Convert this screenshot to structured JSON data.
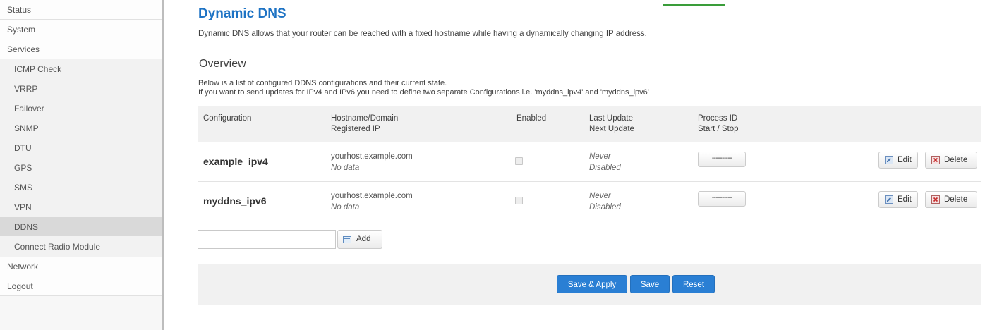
{
  "sidebar": {
    "items": [
      {
        "label": "Status",
        "level": "top"
      },
      {
        "label": "System",
        "level": "top"
      },
      {
        "label": "Services",
        "level": "top"
      },
      {
        "label": "ICMP Check",
        "level": "sub"
      },
      {
        "label": "VRRP",
        "level": "sub"
      },
      {
        "label": "Failover",
        "level": "sub"
      },
      {
        "label": "SNMP",
        "level": "sub"
      },
      {
        "label": "DTU",
        "level": "sub"
      },
      {
        "label": "GPS",
        "level": "sub"
      },
      {
        "label": "SMS",
        "level": "sub"
      },
      {
        "label": "VPN",
        "level": "sub"
      },
      {
        "label": "DDNS",
        "level": "sub",
        "active": true
      },
      {
        "label": "Connect Radio Module",
        "level": "sub"
      },
      {
        "label": "Network",
        "level": "top"
      },
      {
        "label": "Logout",
        "level": "top"
      }
    ]
  },
  "page": {
    "title": "Dynamic DNS",
    "description": "Dynamic DNS allows that your router can be reached with a fixed hostname while having a dynamically changing IP address."
  },
  "overview": {
    "title": "Overview",
    "desc1": "Below is a list of configured DDNS configurations and their current state.",
    "desc2": "If you want to send updates for IPv4 and IPv6 you need to define two separate Configurations i.e. 'myddns_ipv4' and 'myddns_ipv6'"
  },
  "table": {
    "headers": {
      "configuration": "Configuration",
      "hostname": "Hostname/Domain",
      "registered_ip": "Registered IP",
      "enabled": "Enabled",
      "last_update": "Last Update",
      "next_update": "Next Update",
      "process_id": "Process ID",
      "start_stop": "Start / Stop"
    },
    "rows": [
      {
        "name": "example_ipv4",
        "hostname": "yourhost.example.com",
        "registered_ip": "No data",
        "enabled": false,
        "last_update": "Never",
        "next_update": "Disabled",
        "process_button": "----------",
        "edit_label": "Edit",
        "delete_label": "Delete"
      },
      {
        "name": "myddns_ipv6",
        "hostname": "yourhost.example.com",
        "registered_ip": "No data",
        "enabled": false,
        "last_update": "Never",
        "next_update": "Disabled",
        "process_button": "----------",
        "edit_label": "Edit",
        "delete_label": "Delete"
      }
    ]
  },
  "add": {
    "input_value": "",
    "button_label": "Add"
  },
  "footer": {
    "save_apply_label": "Save & Apply",
    "save_label": "Save",
    "reset_label": "Reset"
  },
  "colors": {
    "accent": "#2a7fd4",
    "title": "#1e73c4",
    "active_item": "#d9d9d9",
    "tab_indicator": "#3a9d3a"
  },
  "icons": {
    "edit": "edit-icon",
    "delete": "delete-icon",
    "add": "add-icon"
  }
}
